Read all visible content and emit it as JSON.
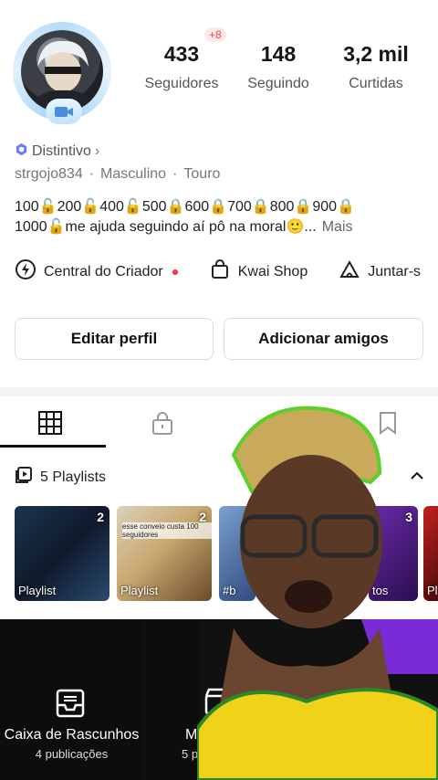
{
  "profile": {
    "stats": [
      {
        "value": "433",
        "label": "Seguidores"
      },
      {
        "value": "148",
        "label": "Seguindo"
      },
      {
        "value": "3,2 mil",
        "label": "Curtidas"
      }
    ],
    "new_followers": "+8",
    "distintivo": "Distintivo",
    "username": "strgojo834",
    "gender": "Masculino",
    "sign": "Touro",
    "bio_line1": "100🔓200🔓400🔓500🔒600🔒700🔒800🔒900🔒",
    "bio_line2": "1000🔓me ajuda seguindo aí pô na moral🙂...",
    "bio_more": "Mais"
  },
  "shortcuts": [
    {
      "label": "Central do Criador",
      "icon": "lightning-icon"
    },
    {
      "label": "Kwai Shop",
      "icon": "shopping-bag-icon"
    },
    {
      "label": "Juntar-s",
      "icon": "tent-icon"
    }
  ],
  "buttons": {
    "edit": "Editar perfil",
    "add": "Adicionar amigos"
  },
  "playlists": {
    "header": "5 Playlists",
    "items": [
      {
        "count": "2",
        "caption": "Playlist"
      },
      {
        "count": "2",
        "caption": "Playlist",
        "overlay_text": "esse conveio custa 100 seguidores"
      },
      {
        "count": "",
        "caption": "#b"
      },
      {
        "count": "3",
        "caption": "tos"
      },
      {
        "count": "",
        "caption": "Pl"
      }
    ]
  },
  "grid": {
    "drafts_title": "Caixa de Rascunhos",
    "drafts_sub": "4 publicações",
    "second_title": "Me",
    "second_sub": "5 pu"
  },
  "colors": {
    "accent_red": "#ff2b3a",
    "badge_blue": "#6b7cff"
  }
}
